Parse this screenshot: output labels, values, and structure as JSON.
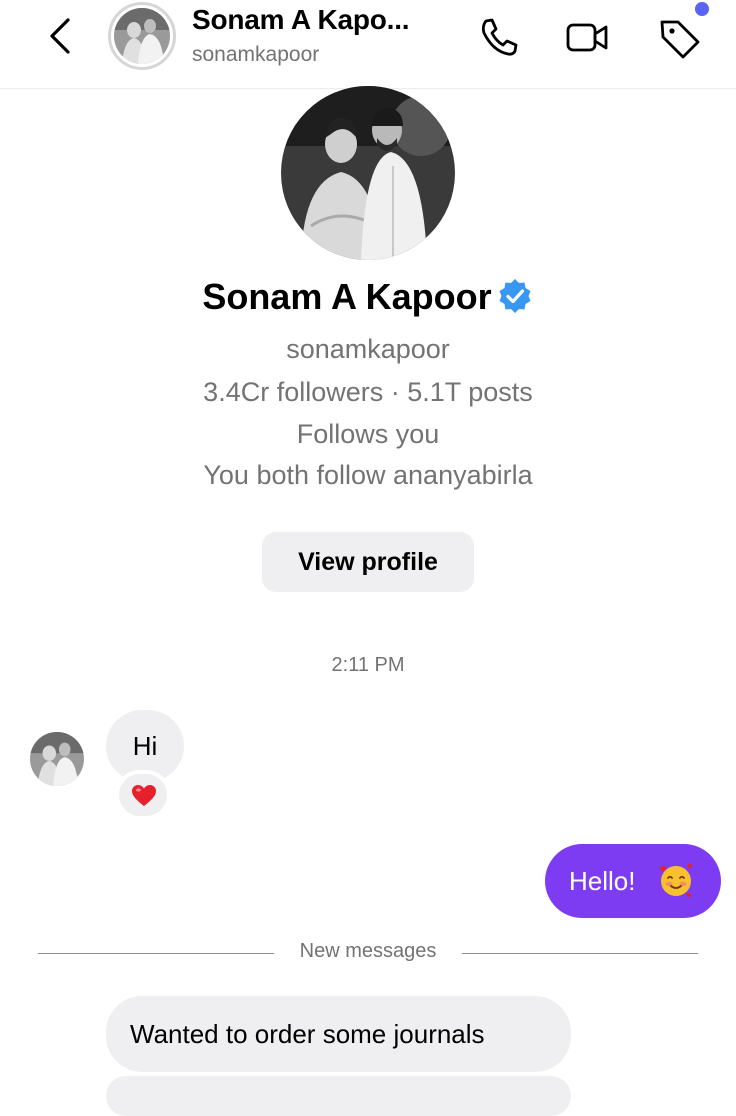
{
  "header": {
    "name": "Sonam A Kapo...",
    "username": "sonamkapoor",
    "icons": [
      "back-chevron-icon",
      "phone-icon",
      "video-camera-icon",
      "tag-icon"
    ],
    "notification_dot_color": "#5b63f5"
  },
  "profile": {
    "name": "Sonam A Kapoor",
    "verified": true,
    "username": "sonamkapoor",
    "stats": "3.4Cr followers · 5.1T posts",
    "follows_you": "Follows you",
    "mutual": "You both follow ananyabirla",
    "view_profile_label": "View profile"
  },
  "chat": {
    "timestamp": "2:11 PM",
    "messages": [
      {
        "from": "them",
        "text": "Hi",
        "reaction": "❤️"
      },
      {
        "from": "me",
        "text": "Hello!",
        "emoji": "🥰"
      },
      {
        "from": "them",
        "text": "Wanted to order some journals"
      }
    ],
    "new_messages_label": "New messages"
  },
  "colors": {
    "outgoing_bubble": "#7d3cf2",
    "incoming_bubble": "#efeff1",
    "verified_badge": "#3897f0",
    "secondary_text": "#737373"
  }
}
